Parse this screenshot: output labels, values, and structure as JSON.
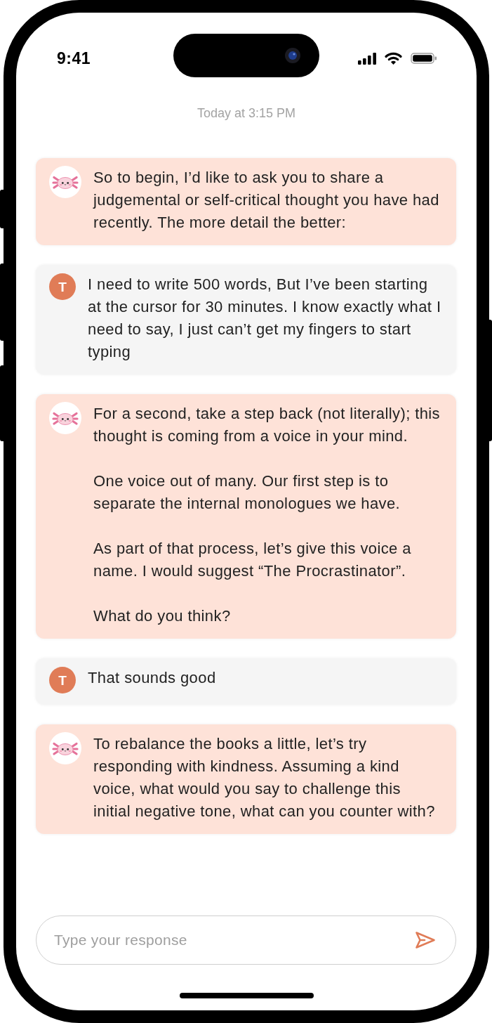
{
  "status_bar": {
    "time": "9:41"
  },
  "timestamp": "Today at 3:15 PM",
  "messages": [
    {
      "kind": "bot",
      "paragraphs": [
        "So to begin, I’d like to ask you to share a judgemental or self-critical thought you have had recently. The more detail the better:"
      ]
    },
    {
      "kind": "user",
      "avatar_initial": "T",
      "paragraphs": [
        "I need to write 500 words, But I’ve been starting at the cursor for 30 minutes. I know exactly what I need to say, I just can’t get my fingers to start typing"
      ]
    },
    {
      "kind": "bot",
      "paragraphs": [
        "For a second, take a step back (not literally); this thought is coming from a voice in your mind.",
        "One voice out of many. Our first step is to separate the internal monologues we have.",
        "As part of that process, let’s give this voice a name. I would suggest “The Procrastinator”.",
        "What do you think?"
      ]
    },
    {
      "kind": "user",
      "avatar_initial": "T",
      "paragraphs": [
        "That sounds good"
      ]
    },
    {
      "kind": "bot",
      "paragraphs": [
        "To rebalance the books a little, let’s try responding with kindness. Assuming a kind voice, what would you say to challenge this initial negative tone, what can you counter with?"
      ]
    }
  ],
  "composer": {
    "placeholder": "Type your response"
  }
}
